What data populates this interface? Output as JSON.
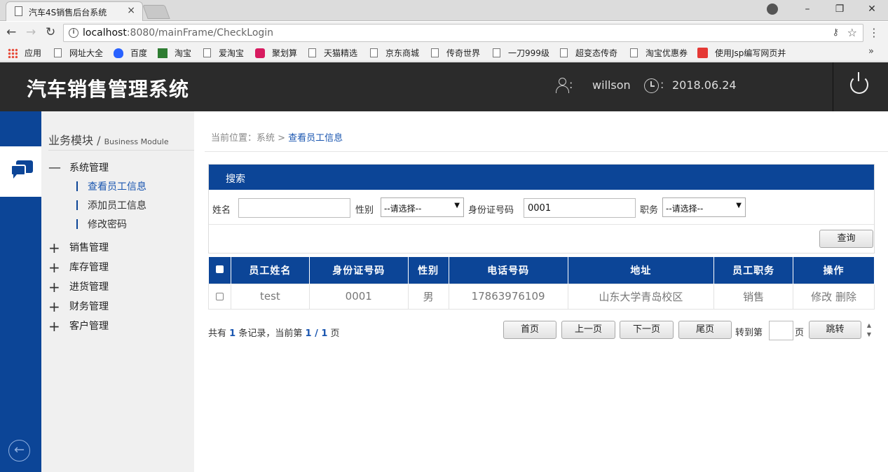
{
  "browser": {
    "tab_title": "汽车4S销售后台系统",
    "tab_close": "×",
    "url_host": "localhost",
    "url_rest": ":8080/mainFrame/CheckLogin",
    "bookmarks": [
      {
        "label": "应用",
        "icon": "apps-icon"
      },
      {
        "label": "网址大全",
        "icon": "page-icon"
      },
      {
        "label": "百度",
        "icon": "baidu-icon"
      },
      {
        "label": "淘宝",
        "icon": "taobao-icon"
      },
      {
        "label": "爱淘宝",
        "icon": "page-icon"
      },
      {
        "label": "聚划算",
        "icon": "ju-icon"
      },
      {
        "label": "天猫精选",
        "icon": "page-icon"
      },
      {
        "label": "京东商城",
        "icon": "page-icon"
      },
      {
        "label": "传奇世界",
        "icon": "page-icon"
      },
      {
        "label": "一刀999级",
        "icon": "page-icon"
      },
      {
        "label": "超变态传奇",
        "icon": "page-icon"
      },
      {
        "label": "淘宝优惠券",
        "icon": "page-icon"
      },
      {
        "label": "使用Jsp编写网页并",
        "icon": "c-icon"
      }
    ],
    "bookmarks_more": "»"
  },
  "header": {
    "title": "汽车销售管理系统",
    "username": "willson",
    "date": "2018.06.24",
    "colon": ":"
  },
  "sidebar": {
    "module_title": "业务模块",
    "module_slash": "/",
    "module_title_en": "Business Module",
    "groups": [
      {
        "label": "系统管理",
        "expanded": true,
        "sign": "—",
        "items": [
          {
            "label": "查看员工信息",
            "active": true
          },
          {
            "label": "添加员工信息",
            "active": false
          },
          {
            "label": "修改密码",
            "active": false
          }
        ]
      },
      {
        "label": "销售管理",
        "expanded": false,
        "sign": "+"
      },
      {
        "label": "库存管理",
        "expanded": false,
        "sign": "+"
      },
      {
        "label": "进货管理",
        "expanded": false,
        "sign": "+"
      },
      {
        "label": "财务管理",
        "expanded": false,
        "sign": "+"
      },
      {
        "label": "客户管理",
        "expanded": false,
        "sign": "+"
      }
    ]
  },
  "breadcrumb": {
    "prefix": "当前位置：系统 >",
    "current": "查看员工信息"
  },
  "search": {
    "title": "搜索",
    "name_label": "姓名",
    "name_value": "",
    "gender_label": "性别",
    "gender_value": "--请选择--",
    "id_label": "身份证号码",
    "id_value": "0001",
    "position_label": "职务",
    "position_value": "--请选择--",
    "query_button": "查询"
  },
  "table": {
    "columns": [
      "员工姓名",
      "身份证号码",
      "性别",
      "电话号码",
      "地址",
      "员工职务",
      "操作"
    ],
    "rows": [
      {
        "name": "test",
        "id": "0001",
        "gender": "男",
        "phone": "17863976109",
        "address": "山东大学青岛校区",
        "position": "销售",
        "edit": "修改",
        "delete": "删除"
      }
    ]
  },
  "pagination": {
    "summary_a": "共有",
    "total": "1",
    "summary_b": "条记录，当前第",
    "current": "1 / 1",
    "summary_c": "页",
    "first": "首页",
    "prev": "上一页",
    "next": "下一页",
    "last": "尾页",
    "goto_label": "转到第",
    "page_suffix": "页",
    "jump_button": "跳转"
  }
}
